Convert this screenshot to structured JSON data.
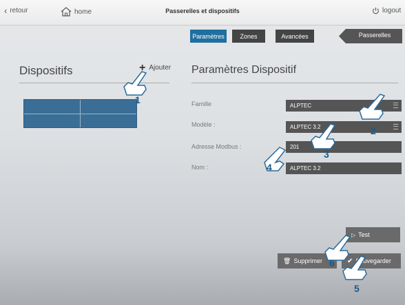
{
  "topbar": {
    "back_label": "retour",
    "home_label": "home",
    "title": "Passerelles et dispositifs",
    "logout_label": "logout"
  },
  "tabs": [
    {
      "label": "Paramètres",
      "active": true
    },
    {
      "label": "Zones",
      "active": false
    },
    {
      "label": "Avancées",
      "active": false
    }
  ],
  "gateway_button": "Passerelles",
  "left": {
    "title": "Dispositifs",
    "add_label": "Ajouter"
  },
  "right": {
    "title": "Paramètres Dispositif",
    "fields": [
      {
        "label": "Famille",
        "value": "ALPTEC"
      },
      {
        "label": "Modèle :",
        "value": "ALPTEC 3.2"
      },
      {
        "label": "Adresse Modbus :",
        "value": "201"
      },
      {
        "label": "Nom :",
        "value": "ALPTEC 3.2"
      }
    ]
  },
  "buttons": {
    "test": "Test",
    "delete": "Supprimer",
    "save": "Sauvegarder"
  },
  "callouts": [
    "1",
    "2",
    "3",
    "4",
    "5",
    "6"
  ],
  "colors": {
    "accent": "#1f6fa0",
    "callout": "#1a5a88"
  }
}
